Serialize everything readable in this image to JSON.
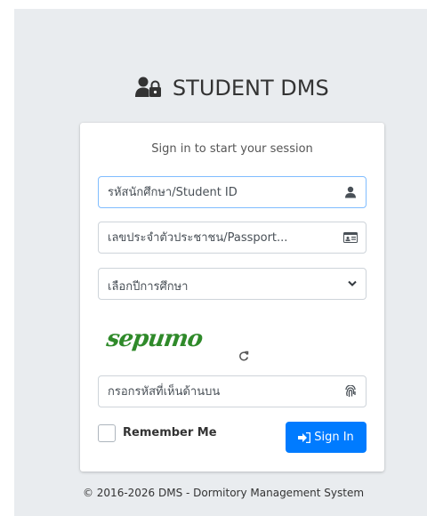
{
  "brand": {
    "title": "STUDENT DMS",
    "icon": "user-lock-icon"
  },
  "login": {
    "message": "Sign in to start your session",
    "student_id_placeholder": "รหัสนักศึกษา/Student ID",
    "citizen_id_placeholder": "เลขประจำตัวประชาชน/Passport...",
    "year_select_value": "เลือกปีการศึกษา",
    "captcha_text": "sepumo",
    "captcha_input_placeholder": "กรอกรหัสที่เห็นด้านบน",
    "remember_label": "Remember Me",
    "signin_label": "Sign In"
  },
  "footer": {
    "text": "© 2016-2026 DMS - Dormitory Management System"
  },
  "colors": {
    "primary": "#007bff",
    "captcha": "#2f8a2a",
    "background": "#e9ecef"
  }
}
